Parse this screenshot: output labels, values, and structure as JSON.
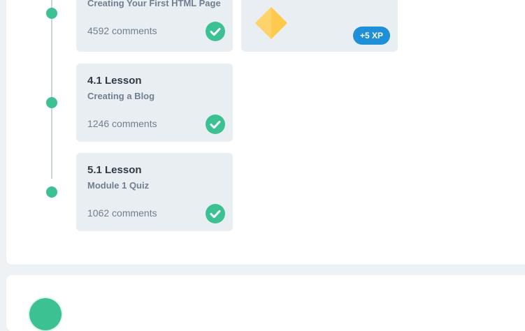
{
  "colors": {
    "accent_green": "#3cc193",
    "xp_blue": "#1e90d7",
    "diamond_yellow": "#ffc94d",
    "card_bg": "#e9eef2"
  },
  "lessons": [
    {
      "title": "",
      "subtitle": "Creating Your First HTML Page",
      "comments": "4592 comments",
      "icon": "check-circle-icon"
    },
    {
      "title": "4.1 Lesson",
      "subtitle": "Creating a Blog",
      "comments": "1246 comments",
      "icon": "check-circle-icon"
    },
    {
      "title": "5.1 Lesson",
      "subtitle": "Module 1 Quiz",
      "comments": "1062 comments",
      "icon": "check-circle-icon"
    }
  ],
  "reward": {
    "xp_label": "+5 XP",
    "icon": "diamond-icon"
  }
}
